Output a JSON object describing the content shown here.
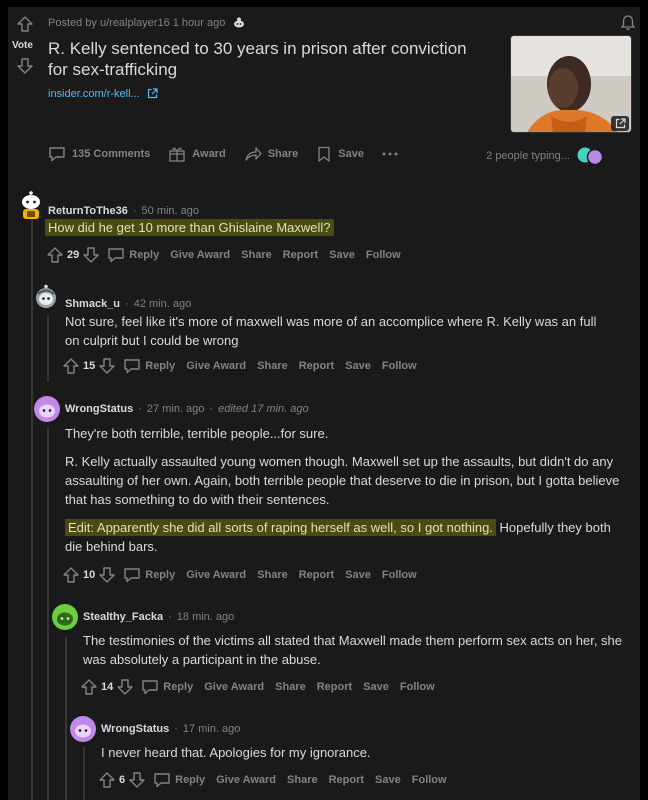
{
  "post": {
    "meta": "Posted by u/realplayer16 1 hour ago",
    "vote_label": "Vote",
    "title": "R. Kelly sentenced to 30 years in prison after conviction for sex-trafficking",
    "link": "insider.com/r-kell...",
    "actions": {
      "comments": "135 Comments",
      "award": "Award",
      "share": "Share",
      "save": "Save"
    },
    "typing": "2 people typing..."
  },
  "action_labels": {
    "reply": "Reply",
    "give_award": "Give Award",
    "share": "Share",
    "report": "Report",
    "save": "Save",
    "follow": "Follow"
  },
  "comments": [
    {
      "user": "ReturnToThe36",
      "time": "50 min. ago",
      "text": "How did he get 10 more than Ghislaine Maxwell?",
      "votes": "29"
    },
    {
      "user": "Shmack_u",
      "time": "42 min. ago",
      "text": "Not sure, feel like it's more of maxwell was more of an accomplice where R. Kelly was an full on culprit but I could be wrong",
      "votes": "15"
    },
    {
      "user": "WrongStatus",
      "time": "27 min. ago",
      "edited": "edited 17 min. ago",
      "p1": "They're both terrible, terrible people...for sure.",
      "p2": "R. Kelly actually assaulted young women though. Maxwell set up the assaults, but didn't do any assaulting of her own. Again, both terrible people that deserve to die in prison, but I gotta believe that has something to do with their sentences.",
      "p3_highlight": "Edit: Apparently she did all sorts of raping herself as well, so I got nothing.",
      "p3_rest": " Hopefully they both die behind bars.",
      "votes": "10"
    },
    {
      "user": "Stealthy_Facka",
      "time": "18 min. ago",
      "text": "The testimonies of the victims all stated that Maxwell made them perform sex acts on her, she was absolutely a participant in the abuse.",
      "votes": "14"
    },
    {
      "user": "WrongStatus",
      "time": "17 min. ago",
      "text": "I never heard that. Apologies for my ignorance.",
      "votes": "6"
    }
  ],
  "colors": {
    "background": "#1a1a1b",
    "text": "#d7dadc",
    "muted": "#818384",
    "link": "#4fbcff",
    "highlight": "#4a4a13"
  }
}
